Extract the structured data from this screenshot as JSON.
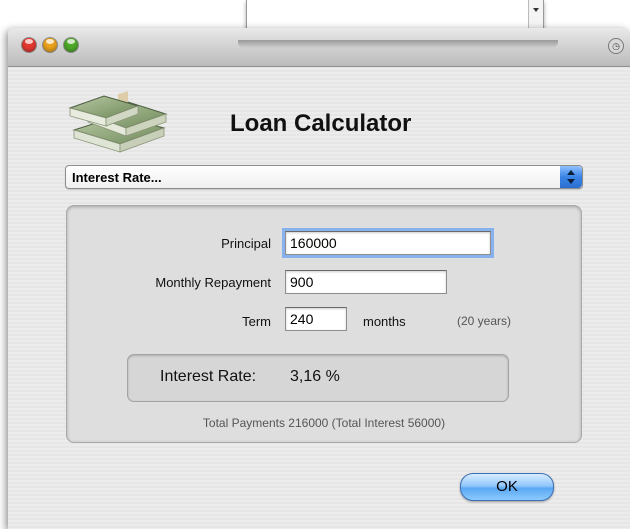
{
  "window": {
    "title": "Loan Calculator"
  },
  "popup": {
    "selected": "Interest Rate..."
  },
  "form": {
    "principal_label": "Principal",
    "principal_value": "160000",
    "repayment_label": "Monthly Repayment",
    "repayment_value": "900",
    "term_label": "Term",
    "term_value": "240",
    "term_unit": "months",
    "term_note": "(20 years)"
  },
  "result": {
    "label": "Interest Rate:",
    "value": "3,16 %"
  },
  "totals": "Total Payments 216000 (Total Interest 56000)",
  "buttons": {
    "ok": "OK"
  },
  "icons": {
    "money": "money-stack-icon",
    "clock": "clock-icon",
    "popup_arrows": "up-down-arrows-icon"
  },
  "colors": {
    "accent": "#3a84e6",
    "close": "#e2382f",
    "minimize": "#e9a21d",
    "zoom": "#4ea82a"
  }
}
